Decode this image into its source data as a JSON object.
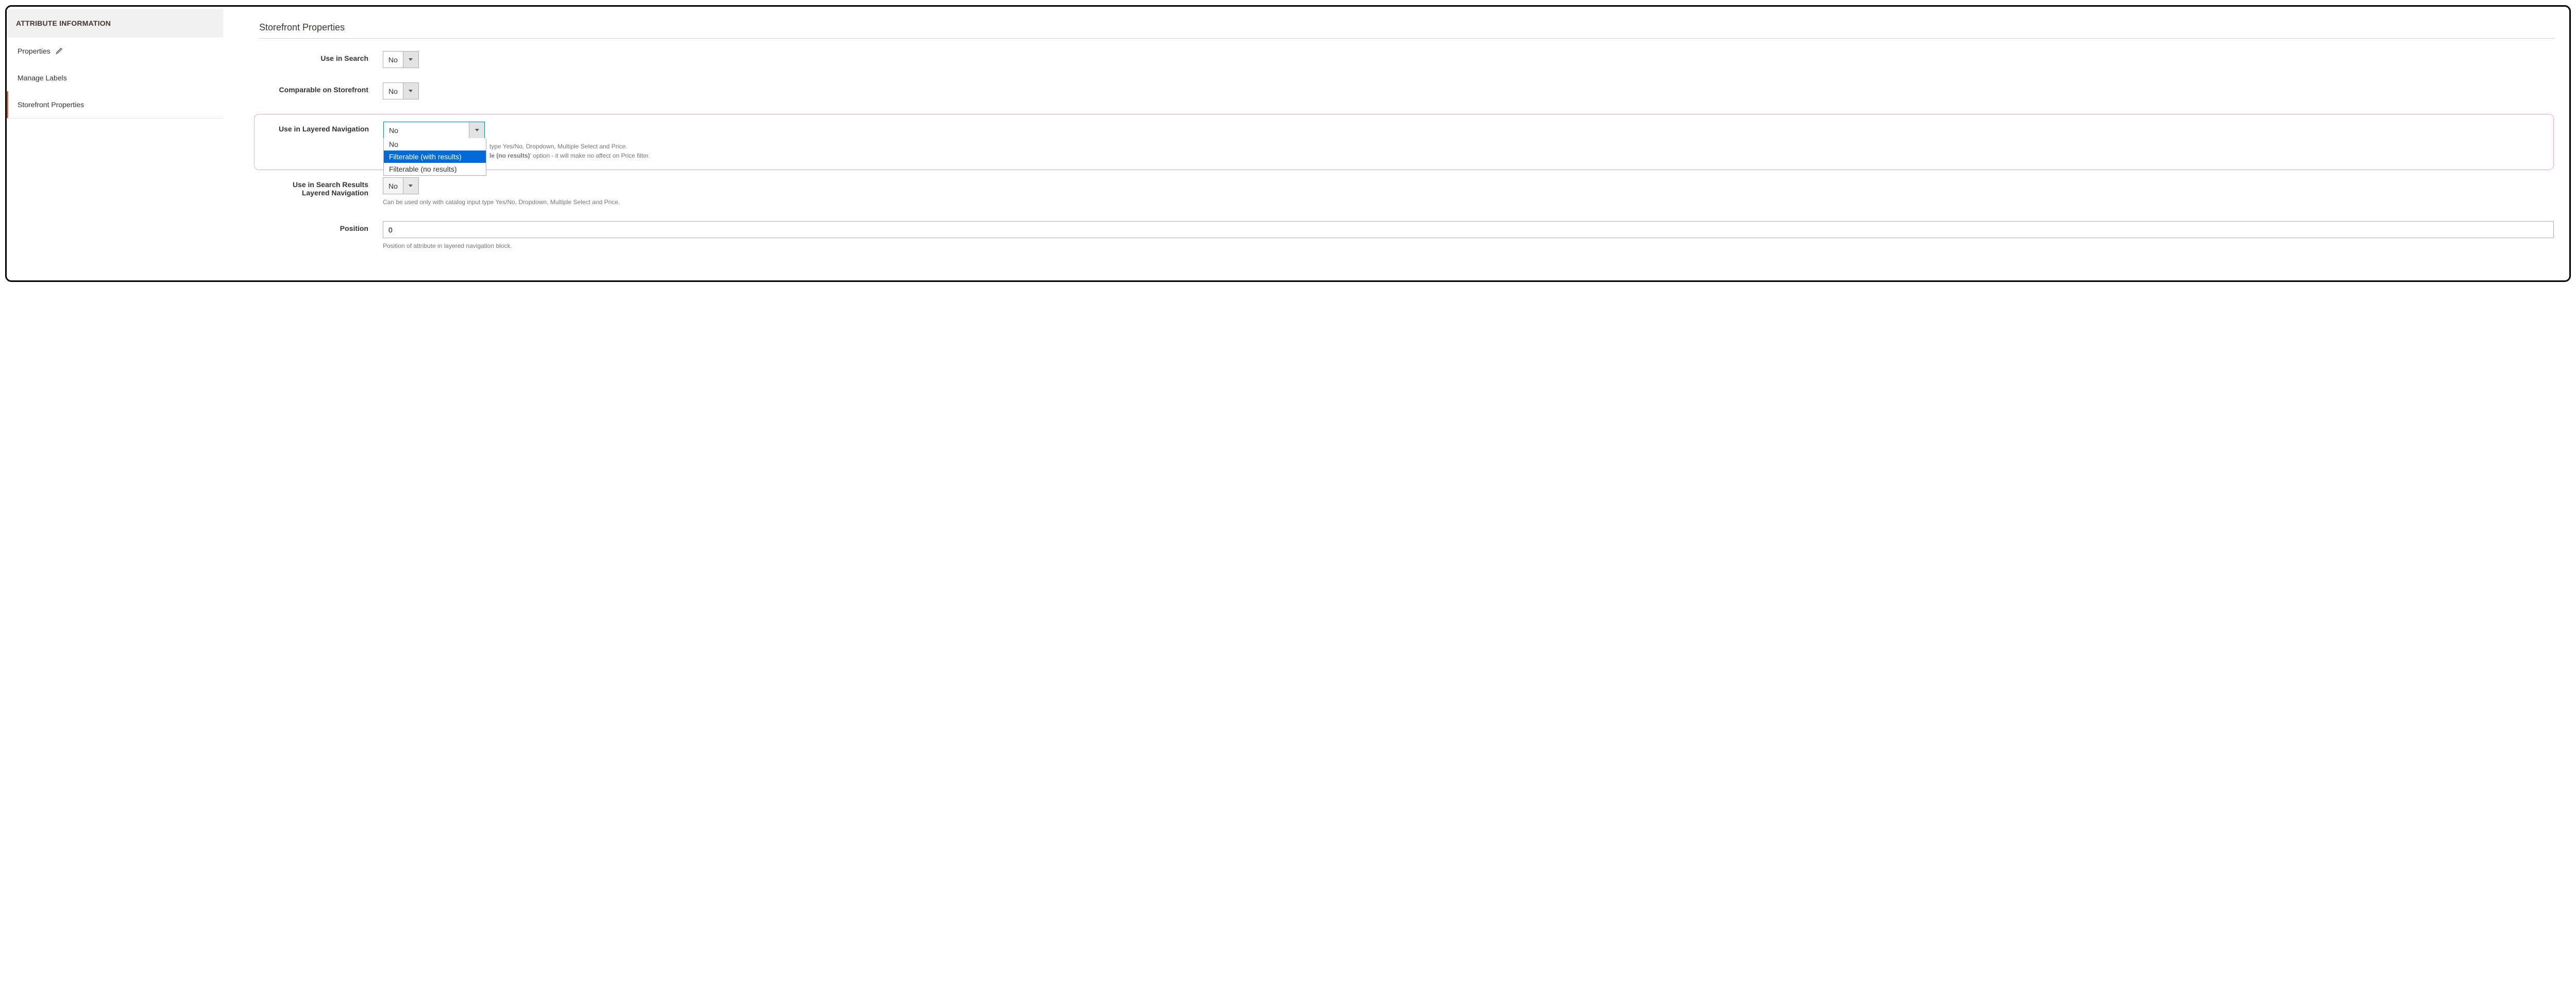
{
  "sidebar": {
    "header": "ATTRIBUTE INFORMATION",
    "items": [
      {
        "label": "Properties",
        "icon": "pencil"
      },
      {
        "label": "Manage Labels"
      },
      {
        "label": "Storefront Properties",
        "active": true
      }
    ]
  },
  "section_title": "Storefront Properties",
  "fields": {
    "use_in_search": {
      "label": "Use in Search",
      "value": "No"
    },
    "comparable": {
      "label": "Comparable on Storefront",
      "value": "No"
    },
    "layered_nav": {
      "label": "Use in Layered Navigation",
      "value": "No",
      "options": [
        "No",
        "Filterable (with results)",
        "Filterable (no results)"
      ],
      "help_line1_suffix": "type Yes/No, Dropdown, Multiple Select and Price.",
      "help_line2_bold": "le (no results)",
      "help_line2_suffix": "' option - it will make no affect on Price filter."
    },
    "search_results_layered": {
      "label_line1": "Use in Search Results",
      "label_line2": "Layered Navigation",
      "value": "No",
      "help": "Can be used only with catalog input type Yes/No, Dropdown, Multiple Select and Price."
    },
    "position": {
      "label": "Position",
      "value": "0",
      "help": "Position of attribute in layered navigation block."
    }
  }
}
